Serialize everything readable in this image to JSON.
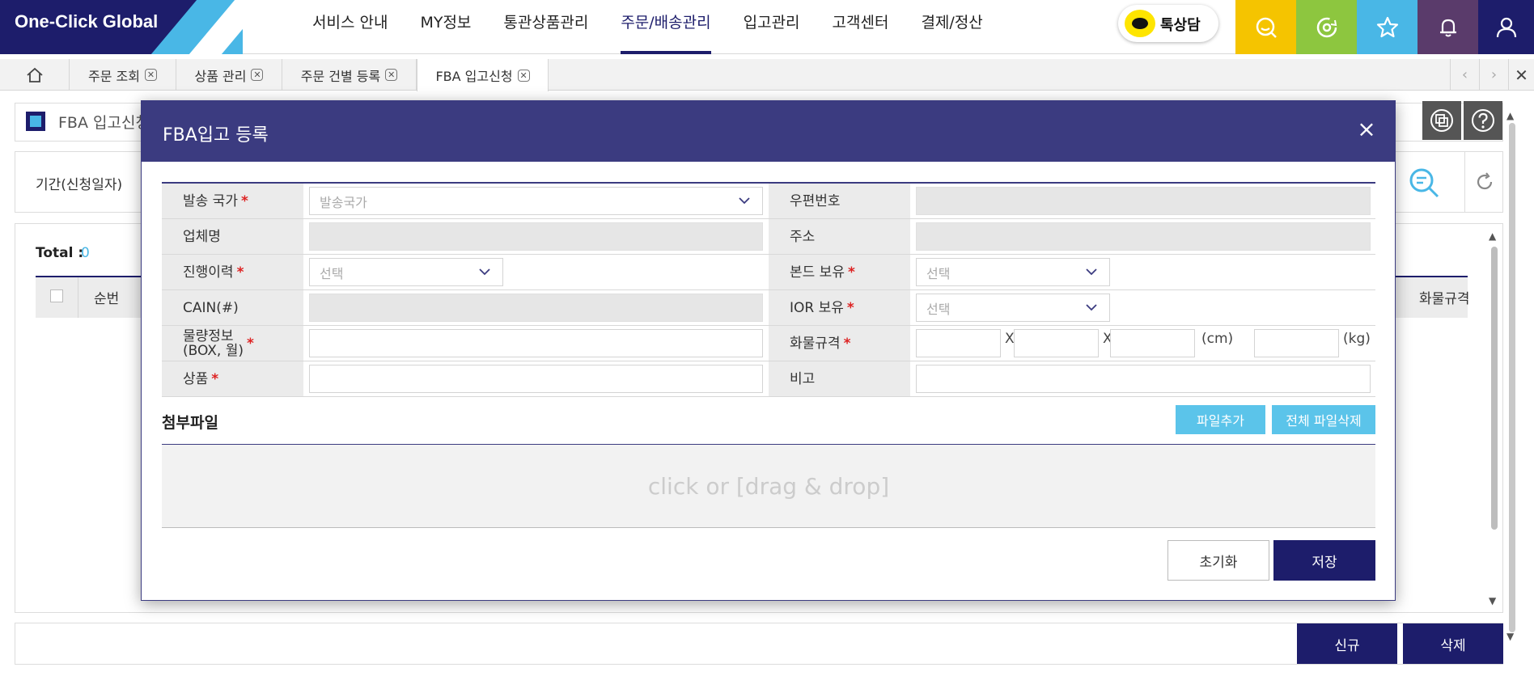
{
  "app": {
    "logo": "One-Click Global",
    "talk_label": "톡상담"
  },
  "topnav": [
    {
      "label": "서비스 안내"
    },
    {
      "label": "MY정보"
    },
    {
      "label": "통관상품관리"
    },
    {
      "label": "주문/배송관리"
    },
    {
      "label": "입고관리"
    },
    {
      "label": "고객센터"
    },
    {
      "label": "결제/정산"
    }
  ],
  "toolbar_buttons": [
    {
      "icon": "search-chat-icon",
      "color": "#f5c400"
    },
    {
      "icon": "settings-refresh-icon",
      "color": "#8dc63f"
    },
    {
      "icon": "star-icon",
      "color": "#49b7e6"
    },
    {
      "icon": "bell-icon",
      "color": "#5a3b6b"
    },
    {
      "icon": "user-icon",
      "color": "#1d1d6b"
    }
  ],
  "tabs": [
    {
      "label": "주문 조회"
    },
    {
      "label": "상품 관리"
    },
    {
      "label": "주문 건별 등록"
    },
    {
      "label": "FBA 입고신청"
    }
  ],
  "background": {
    "page_title": "FBA 입고신청",
    "period_label": "기간(신청일자)",
    "total_label": "Total :",
    "total_value": "0",
    "col_seq": "순번",
    "col_cargo": "화물규격",
    "btn_new": "신규",
    "btn_delete": "삭제"
  },
  "modal": {
    "title": "FBA입고 등록",
    "close": "×",
    "fields": {
      "country_label": "발송 국가",
      "country_placeholder": "발송국가",
      "zip_label": "우편번호",
      "company_label": "업체명",
      "address_label": "주소",
      "history_label": "진행이력",
      "history_placeholder": "선택",
      "bond_label": "본드 보유",
      "bond_placeholder": "선택",
      "cain_label": "CAIN(#)",
      "ior_label": "IOR 보유",
      "ior_placeholder": "선택",
      "qty_label_line1": "물량정보",
      "qty_label_line2": "(BOX, 월)",
      "cargo_label": "화물규격",
      "cargo_x1": "X",
      "cargo_x2": "X",
      "cargo_unit_cm": "(cm)",
      "cargo_unit_kg": "(kg)",
      "product_label": "상품",
      "note_label": "비고",
      "required_mark": "*"
    },
    "attach_label": "첨부파일",
    "btn_add_file": "파일추가",
    "btn_delete_all": "전체 파일삭제",
    "dropzone_text": "click or [drag & drop]",
    "btn_reset": "초기화",
    "btn_save": "저장"
  }
}
